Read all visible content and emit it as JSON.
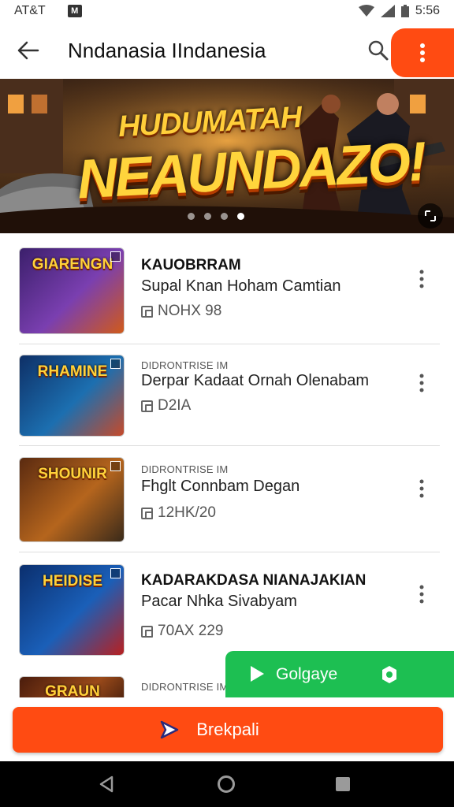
{
  "status_bar": {
    "carrier": "AT&T",
    "badge": "M",
    "time": "5:56"
  },
  "app_bar": {
    "title": "Nndanasia IIndanesia"
  },
  "banner": {
    "line1": "HUDUMATAH",
    "line2": "NEAUNDAZO!",
    "dots_total": 4,
    "dots_active_index": 3
  },
  "items": [
    {
      "overline": "",
      "title": "KAUOBRRAM",
      "subtitle": "Supal Knan Hoham Camtian",
      "meta": "NOHX 98",
      "thumb_text": "GIARENGN",
      "thumb_colors": [
        "#3b1f6b",
        "#7a3fb0",
        "#d05a1a"
      ]
    },
    {
      "overline": "DIDRONTRISE IM",
      "title": "",
      "subtitle": "Derpar Kadaat Ornah Olenabam",
      "meta": "D2IA",
      "thumb_text": "RHAMINE",
      "thumb_colors": [
        "#0e2f66",
        "#1c6fb0",
        "#c64a2a"
      ]
    },
    {
      "overline": "DIDRONTRISE IM",
      "title": "",
      "subtitle": "Fhglt Connbam Degan",
      "meta": "12HK/20",
      "thumb_text": "SHOUNIR",
      "thumb_colors": [
        "#5a2a10",
        "#b5651d",
        "#3a2a1a"
      ]
    },
    {
      "overline": "",
      "title": "KADARAKDASA NIANAJAKIAN",
      "subtitle": "Pacar Nhka Sivabyam",
      "meta": "70AX 229",
      "thumb_text": "HEIDISE",
      "thumb_colors": [
        "#0b2f6e",
        "#1a5fb8",
        "#b82020"
      ]
    },
    {
      "overline": "DIDRONTRISE IM",
      "title": "",
      "subtitle": "",
      "meta": "",
      "thumb_text": "GRAUN",
      "thumb_colors": [
        "#4a1c0c",
        "#9a4a1a",
        "#2a1008"
      ]
    }
  ],
  "play_button": {
    "label": "Golgaye"
  },
  "cta": {
    "label": "Brekpali"
  },
  "colors": {
    "accent_orange": "#ff4b12",
    "play_green": "#1dbf52"
  },
  "icons": [
    "back-arrow-icon",
    "search-icon",
    "more-vert-icon",
    "fullscreen-icon",
    "meta-icon",
    "play-icon",
    "gear-icon",
    "send-icon",
    "nav-back-icon",
    "nav-home-icon",
    "nav-recent-icon"
  ]
}
